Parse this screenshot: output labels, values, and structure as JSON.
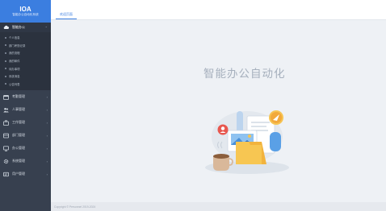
{
  "brand": {
    "title": "IOA",
    "subtitle": "智能办公自动化系统"
  },
  "sidebar": {
    "active_group": "智能办公",
    "sub_items": [
      "个人信息",
      "部门考勤记录",
      "我的流程",
      "我的邮件",
      "待办事项",
      "系统消息",
      "公告列表"
    ],
    "groups": [
      {
        "label": "考勤管理",
        "icon": "calendar-icon"
      },
      {
        "label": "人事管理",
        "icon": "people-icon"
      },
      {
        "label": "工作管理",
        "icon": "briefcase-icon"
      },
      {
        "label": "部门管理",
        "icon": "department-icon"
      },
      {
        "label": "办公管理",
        "icon": "monitor-icon"
      },
      {
        "label": "系统管理",
        "icon": "gear-icon"
      },
      {
        "label": "用户管理",
        "icon": "user-card-icon"
      }
    ]
  },
  "tabs": [
    {
      "label": "欢迎页面"
    }
  ],
  "main": {
    "title": "智能办公自动化"
  },
  "footer": {
    "text": "Copyright © Personnel 2019-2024"
  },
  "colors": {
    "accent": "#3b7ee0",
    "sidebar": "#37404f",
    "background": "#eef1f5"
  }
}
